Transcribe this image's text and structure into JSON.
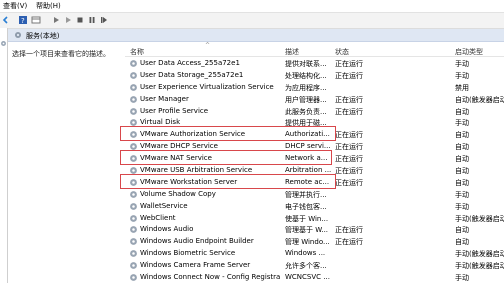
{
  "menu": {
    "view": "查看(V)",
    "help": "帮助(H)"
  },
  "header": {
    "title": "服务(本地)"
  },
  "left_panel": {
    "description": "选择一个项目来查看它的描述。"
  },
  "columns": {
    "name": "名称",
    "description": "描述",
    "status": "状态",
    "startup": "启动类型"
  },
  "rows": [
    {
      "name": "User Data Access_255a72e1",
      "desc": "提供对联系...",
      "status": "正在运行",
      "startup": "手动"
    },
    {
      "name": "User Data Storage_255a72e1",
      "desc": "处理结构化...",
      "status": "正在运行",
      "startup": "手动"
    },
    {
      "name": "User Experience Virtualization Service",
      "desc": "为应用程序...",
      "status": "",
      "startup": "禁用"
    },
    {
      "name": "User Manager",
      "desc": "用户管理器...",
      "status": "正在运行",
      "startup": "自动(触发器启动"
    },
    {
      "name": "User Profile Service",
      "desc": "此服务负责...",
      "status": "正在运行",
      "startup": "自动"
    },
    {
      "name": "Virtual Disk",
      "desc": "提供用于磁...",
      "status": "",
      "startup": "手动"
    },
    {
      "name": "VMware Authorization Service",
      "desc": "Authorizati...",
      "status": "正在运行",
      "startup": "自动"
    },
    {
      "name": "VMware DHCP Service",
      "desc": "DHCP servi...",
      "status": "正在运行",
      "startup": "自动"
    },
    {
      "name": "VMware NAT Service",
      "desc": "Network a...",
      "status": "正在运行",
      "startup": "自动"
    },
    {
      "name": "VMware USB Arbitration Service",
      "desc": "Arbitration ...",
      "status": "正在运行",
      "startup": "自动"
    },
    {
      "name": "VMware Workstation Server",
      "desc": "Remote ac...",
      "status": "正在运行",
      "startup": "自动"
    },
    {
      "name": "Volume Shadow Copy",
      "desc": "管理并执行...",
      "status": "",
      "startup": "手动"
    },
    {
      "name": "WalletService",
      "desc": "电子钱包客...",
      "status": "",
      "startup": "手动"
    },
    {
      "name": "WebClient",
      "desc": "使基于 Win...",
      "status": "",
      "startup": "手动(触发器启动"
    },
    {
      "name": "Windows Audio",
      "desc": "管理基于 W...",
      "status": "正在运行",
      "startup": "自动"
    },
    {
      "name": "Windows Audio Endpoint Builder",
      "desc": "管理 Windo...",
      "status": "正在运行",
      "startup": "自动"
    },
    {
      "name": "Windows Biometric Service",
      "desc": "Windows ...",
      "status": "",
      "startup": "手动(触发器启动"
    },
    {
      "name": "Windows Camera Frame Server",
      "desc": "允许多个客...",
      "status": "",
      "startup": "手动(触发器启动"
    },
    {
      "name": "Windows Connect Now - Config Registrar",
      "desc": "WCNCSVC ...",
      "status": "",
      "startup": "手动"
    }
  ],
  "colors": {
    "highlight": "#d8474b",
    "header_bg": "#dfe7f3"
  },
  "icons": [
    "back-icon",
    "help-icon",
    "play-icon",
    "pause-icon",
    "stop-icon",
    "restart-icon",
    "gear-icon"
  ]
}
